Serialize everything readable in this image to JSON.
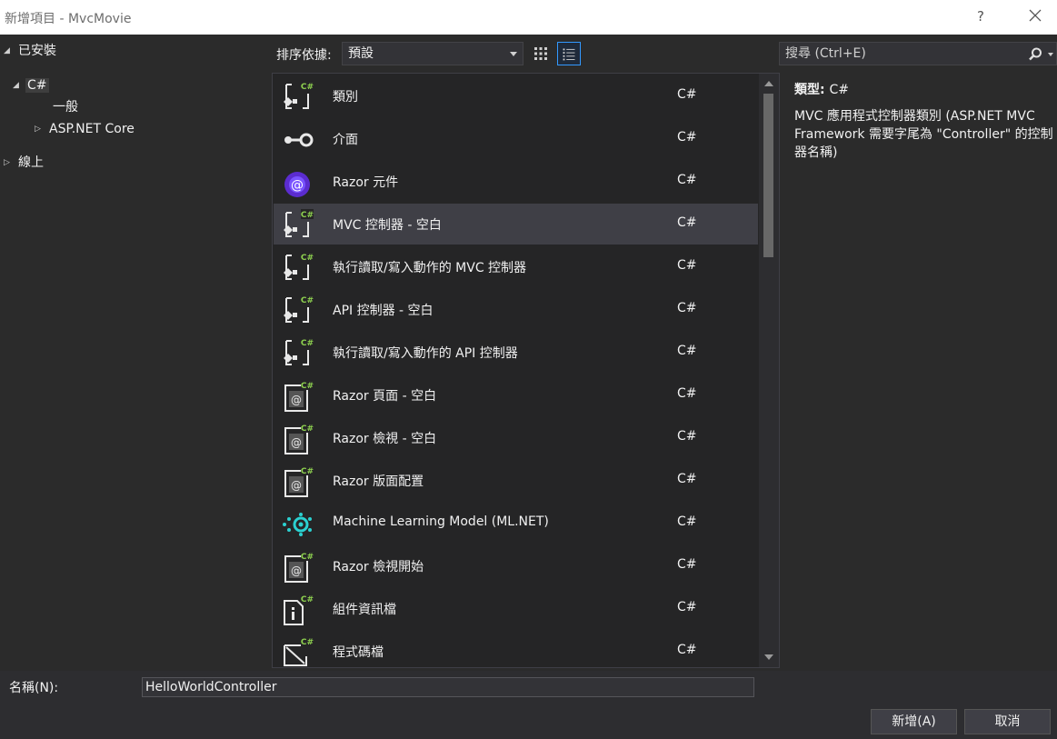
{
  "window": {
    "title": "新增項目 - MvcMovie",
    "help_glyph": "?"
  },
  "tree": {
    "installed": "已安裝",
    "csharp": "C#",
    "general": "一般",
    "aspnet_core": "ASP.NET Core",
    "online": "線上"
  },
  "toolbar": {
    "sort_label": "排序依據:",
    "sort_value": "預設",
    "search_placeholder": "搜尋 (Ctrl+E)"
  },
  "templates": [
    {
      "name": "類別",
      "lang": "C#",
      "icon": "class-icon"
    },
    {
      "name": "介面",
      "lang": "C#",
      "icon": "interface-icon"
    },
    {
      "name": "Razor 元件",
      "lang": "C#",
      "icon": "razor-component-icon"
    },
    {
      "name": "MVC 控制器 - 空白",
      "lang": "C#",
      "icon": "controller-icon",
      "selected": true
    },
    {
      "name": "執行讀取/寫入動作的 MVC 控制器",
      "lang": "C#",
      "icon": "controller-icon"
    },
    {
      "name": "API 控制器 - 空白",
      "lang": "C#",
      "icon": "controller-icon"
    },
    {
      "name": "執行讀取/寫入動作的 API 控制器",
      "lang": "C#",
      "icon": "controller-icon"
    },
    {
      "name": "Razor 頁面 - 空白",
      "lang": "C#",
      "icon": "razor-page-icon"
    },
    {
      "name": "Razor 檢視 - 空白",
      "lang": "C#",
      "icon": "razor-page-icon"
    },
    {
      "name": "Razor 版面配置",
      "lang": "C#",
      "icon": "razor-page-icon"
    },
    {
      "name": "Machine Learning Model (ML.NET)",
      "lang": "C#",
      "icon": "ml-model-icon"
    },
    {
      "name": "Razor 檢視開始",
      "lang": "C#",
      "icon": "razor-page-icon"
    },
    {
      "name": "組件資訊檔",
      "lang": "C#",
      "icon": "assembly-info-icon"
    },
    {
      "name": "程式碼檔",
      "lang": "C#",
      "icon": "code-file-icon"
    }
  ],
  "details": {
    "type_label": "類型:",
    "type_value": "C#",
    "description": "MVC 應用程式控制器類別 (ASP.NET MVC Framework 需要字尾為 \"Controller\" 的控制器名稱)"
  },
  "bottom": {
    "name_label": "名稱(N):",
    "name_value": "HelloWorldController",
    "add_label": "新增(A)",
    "cancel_label": "取消"
  },
  "colors": {
    "accent": "#3399ff",
    "csharp_badge": "#8ed14f",
    "razor_purple": "#7a54ff",
    "ml_cyan": "#2bd0d0"
  }
}
